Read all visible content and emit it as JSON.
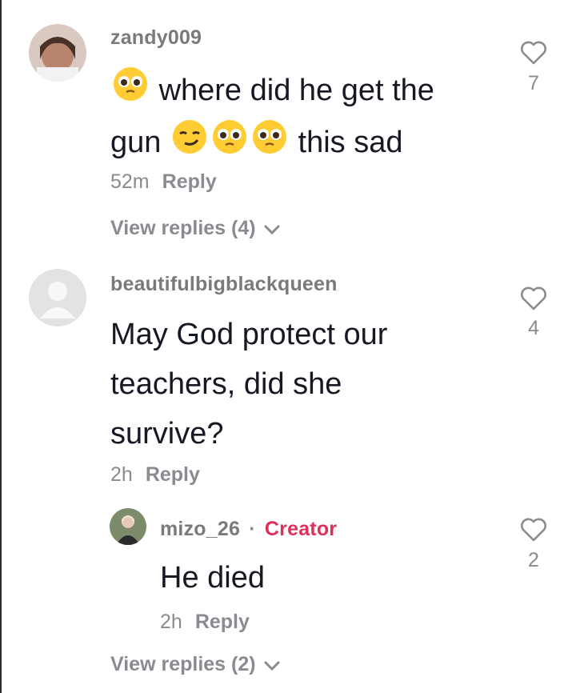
{
  "comments": [
    {
      "username": "zandy009",
      "text_parts": [
        "where did he get the",
        "gun",
        "this sad"
      ],
      "emoji_names": [
        "pleading-face",
        "smirking-face",
        "pleading-face",
        "pleading-face"
      ],
      "time": "52m",
      "reply_label": "Reply",
      "likes": "7",
      "view_replies": "View replies (4)"
    },
    {
      "username": "beautifulbigblackqueen",
      "text_lines": [
        "May God protect our",
        "teachers, did she",
        "survive?"
      ],
      "time": "2h",
      "reply_label": "Reply",
      "likes": "4"
    }
  ],
  "reply": {
    "username": "mizo_26",
    "separator": "·",
    "badge": "Creator",
    "text": "He died",
    "time": "2h",
    "reply_label": "Reply",
    "likes": "2",
    "view_replies": "View replies (2)"
  },
  "colors": {
    "accent": "#e0305a",
    "muted": "#8a8b91",
    "text": "#161823"
  }
}
